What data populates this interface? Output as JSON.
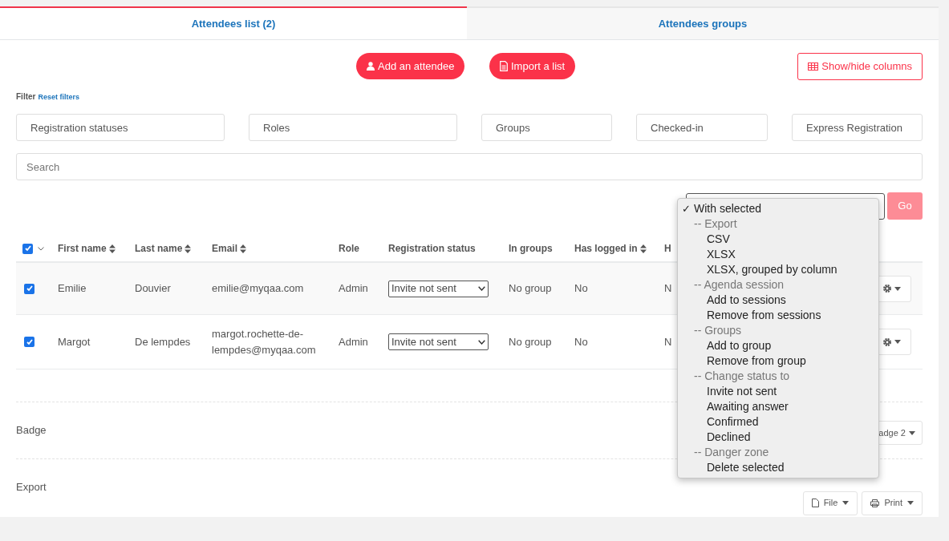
{
  "tabs": [
    {
      "label": "Attendees list (2)",
      "selected": true
    },
    {
      "label": "Attendees groups",
      "selected": false
    }
  ],
  "actions": {
    "add": "Add an attendee",
    "import": "Import a list",
    "columns": "Show/hide columns"
  },
  "filter": {
    "label": "Filter",
    "reset": "Reset filters",
    "fields": [
      {
        "placeholder": "Registration statuses"
      },
      {
        "placeholder": "Roles"
      },
      {
        "placeholder": "Groups"
      },
      {
        "placeholder": "Checked-in"
      },
      {
        "placeholder": "Express Registration"
      }
    ],
    "search": {
      "placeholder": "Search"
    }
  },
  "bulk": {
    "go": "Go",
    "check_mark": "✓",
    "menu": [
      {
        "label": "With selected",
        "kind": "option",
        "selected": true
      },
      {
        "label": "-- Export",
        "kind": "group",
        "selected": false
      },
      {
        "label": "CSV",
        "kind": "option",
        "selected": false
      },
      {
        "label": "XLSX",
        "kind": "option",
        "selected": false
      },
      {
        "label": "XLSX, grouped by column",
        "kind": "option",
        "selected": false
      },
      {
        "label": "-- Agenda session",
        "kind": "group",
        "selected": false
      },
      {
        "label": "Add to sessions",
        "kind": "option",
        "selected": false
      },
      {
        "label": "Remove from sessions",
        "kind": "option",
        "selected": false
      },
      {
        "label": "-- Groups",
        "kind": "group",
        "selected": false
      },
      {
        "label": "Add to group",
        "kind": "option",
        "selected": false
      },
      {
        "label": "Remove from group",
        "kind": "option",
        "selected": false
      },
      {
        "label": "-- Change status to",
        "kind": "group",
        "selected": false
      },
      {
        "label": "Invite not sent",
        "kind": "option",
        "selected": false
      },
      {
        "label": "Awaiting answer",
        "kind": "option",
        "selected": false
      },
      {
        "label": "Confirmed",
        "kind": "option",
        "selected": false
      },
      {
        "label": "Declined",
        "kind": "option",
        "selected": false
      },
      {
        "label": "-- Danger zone",
        "kind": "group",
        "selected": false
      },
      {
        "label": "Delete selected",
        "kind": "option",
        "selected": false
      }
    ]
  },
  "table": {
    "select_all_checked": true,
    "columns": [
      {
        "label": "First name",
        "sortable": true
      },
      {
        "label": "Last name",
        "sortable": true
      },
      {
        "label": "Email",
        "sortable": true
      },
      {
        "label": "Role",
        "sortable": false
      },
      {
        "label": "Registration status",
        "sortable": false
      },
      {
        "label": "In groups",
        "sortable": false
      },
      {
        "label": "Has logged in",
        "sortable": true
      },
      {
        "label": "H",
        "sortable": false
      }
    ],
    "rows": [
      {
        "checked": true,
        "first_name": "Emilie",
        "last_name": "Douvier",
        "email": "emilie@myqaa.com",
        "role": "Admin",
        "status": "Invite not sent",
        "groups": "No group",
        "logged_in": "No",
        "column_8": "N"
      },
      {
        "checked": true,
        "first_name": "Margot",
        "last_name": "De lempdes",
        "email": "margot.rochette-de-lempdes@myqaa.com",
        "role": "Admin",
        "status": "Invite not sent",
        "groups": "No group",
        "logged_in": "No",
        "column_8": "N"
      }
    ]
  },
  "badge": {
    "label": "Badge",
    "button": "adge 2"
  },
  "export": {
    "label": "Export",
    "file": "File",
    "print": "Print"
  }
}
